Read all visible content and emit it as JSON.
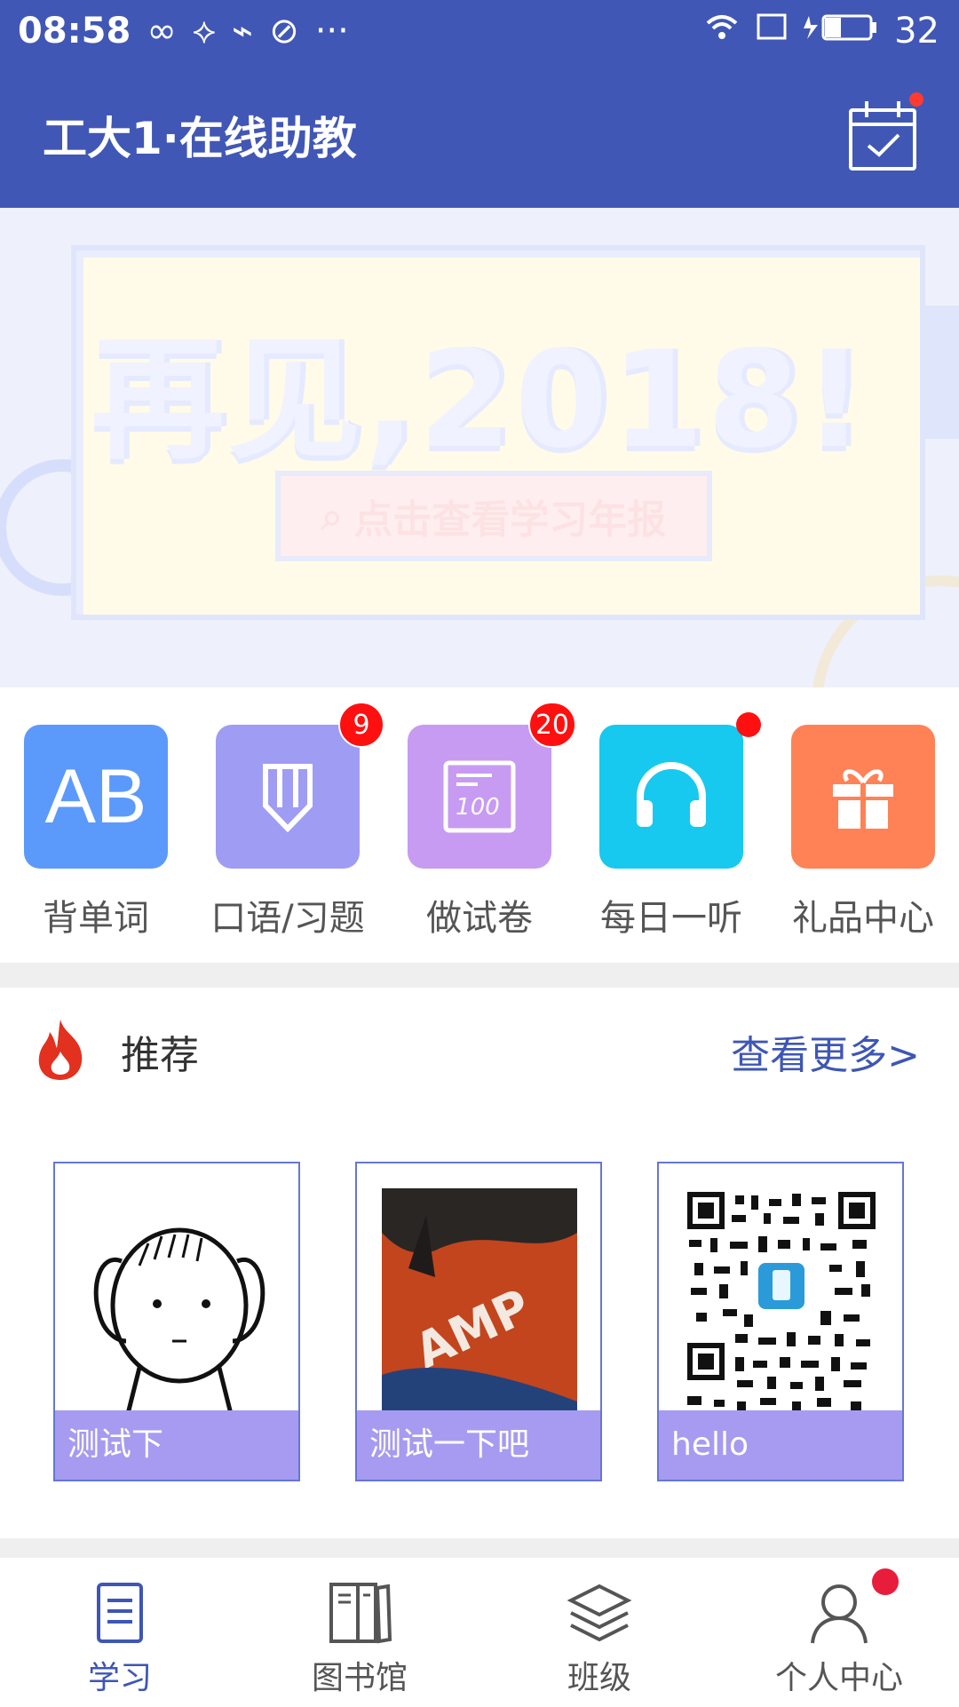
{
  "status_bar": {
    "time": "08:58",
    "battery": "32"
  },
  "header": {
    "title": "工大1·在线助教"
  },
  "banner": {
    "headline": "再见,2018!",
    "cta": "点击查看学习年报",
    "dots": 3,
    "active_index": 0
  },
  "quick_actions": [
    {
      "label": "背单词",
      "icon": "ab-icon",
      "color": "#5b9afb"
    },
    {
      "label": "口语/习题",
      "icon": "pencil-icon",
      "color": "#9f9cf3",
      "badge": "9"
    },
    {
      "label": "做试卷",
      "icon": "exam-icon",
      "color": "#c79bf2",
      "badge": "20"
    },
    {
      "label": "每日一听",
      "icon": "headphones-icon",
      "color": "#17c9ee",
      "dot": true
    },
    {
      "label": "礼品中心",
      "icon": "gift-icon",
      "color": "#ff8256"
    }
  ],
  "recommend": {
    "title": "推荐",
    "more": "查看更多>",
    "cards": [
      {
        "caption": "测试下",
        "image": "cartoon-girl"
      },
      {
        "caption": "测试一下吧",
        "image": "orange-fabric-photo"
      },
      {
        "caption": "hello",
        "image": "qr-code"
      }
    ]
  },
  "bottom_nav": [
    {
      "label": "学习",
      "icon": "document-icon",
      "active": true
    },
    {
      "label": "图书馆",
      "icon": "books-icon"
    },
    {
      "label": "班级",
      "icon": "layers-icon"
    },
    {
      "label": "个人中心",
      "icon": "user-icon",
      "dot": true
    }
  ],
  "colors": {
    "primary": "#4157b5",
    "accent": "#3e56b5",
    "badge": "#ff1010"
  }
}
